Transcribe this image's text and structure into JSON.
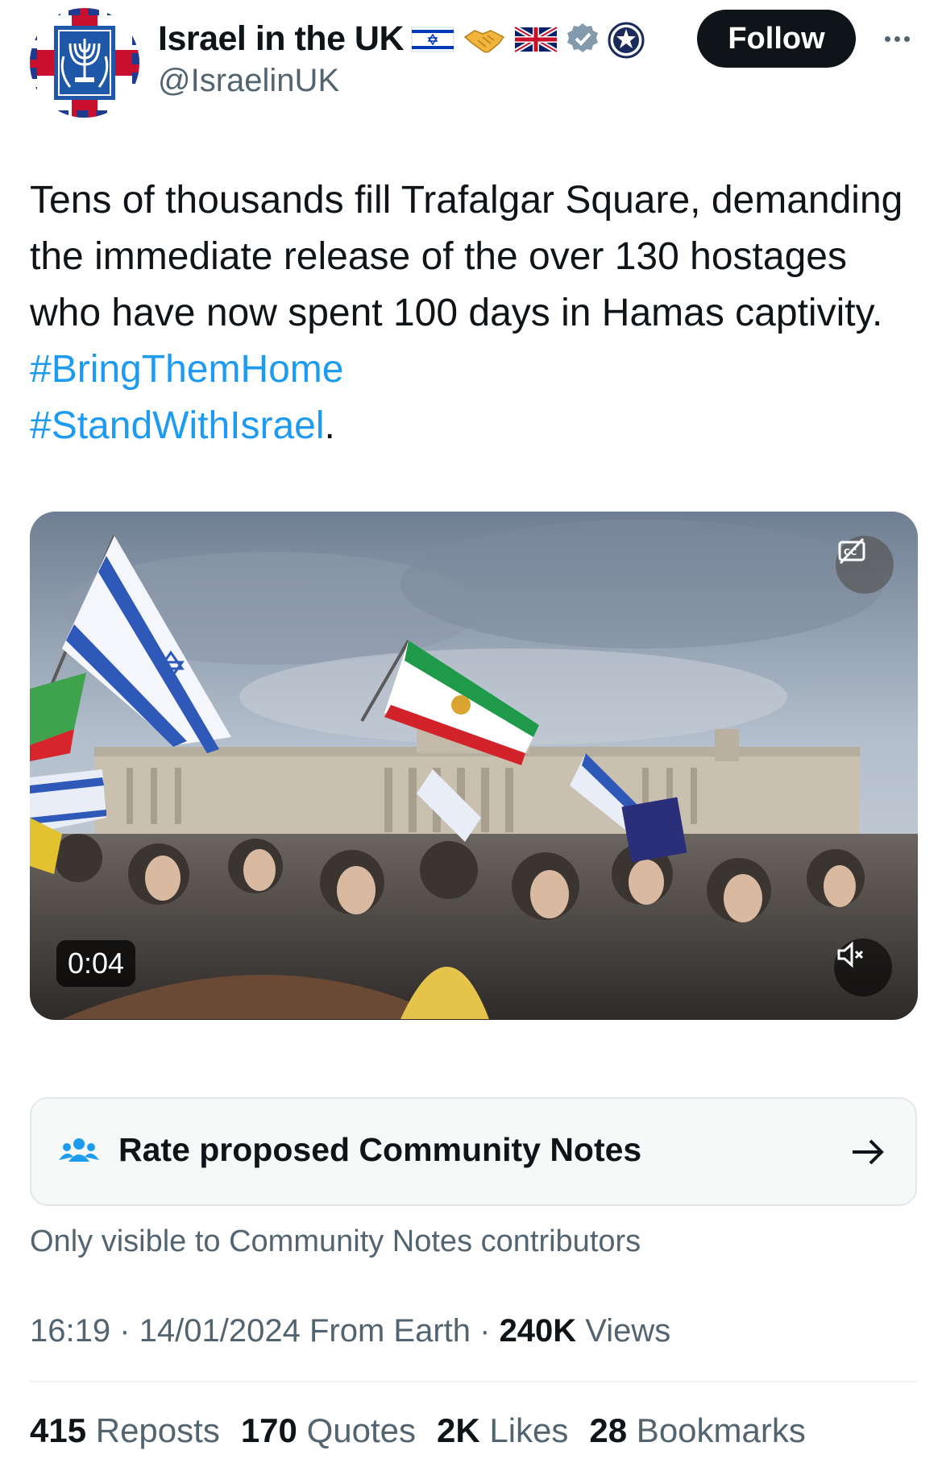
{
  "account": {
    "display_name": "Israel in the UK",
    "handle": "@IsraelinUK",
    "name_emojis": [
      "israel-flag-icon",
      "handshake-icon",
      "uk-flag-icon"
    ],
    "verified_badge": "verified-badge-icon",
    "affiliation_badge": "government-affiliation-icon"
  },
  "actions": {
    "follow_label": "Follow",
    "more_icon": "more-dots-icon"
  },
  "tweet": {
    "text": "Tens of thousands fill Trafalgar Square, demanding the immediate release of the over 130 hostages who have now spent 100 days in Hamas captivity. ",
    "hashtag_1": "#BringThemHome",
    "hashtag_2": "#StandWithIsrael",
    "text_end": "."
  },
  "media": {
    "duration": "0:04",
    "captions_icon": "captions-off-icon",
    "mute_icon": "muted-speaker-icon"
  },
  "community_notes": {
    "title": "Rate proposed Community Notes",
    "visibility_text": "Only visible to Community Notes contributors",
    "icon": "people-icon",
    "arrow_icon": "arrow-right-icon"
  },
  "meta": {
    "time": "16:19",
    "separator": " · ",
    "date": "14/01/2024",
    "source": " From Earth",
    "views_count": "240K",
    "views_label": " Views"
  },
  "stats": {
    "reposts_count": "415",
    "reposts_label": " Reposts",
    "quotes_count": "170",
    "quotes_label": " Quotes",
    "likes_count": "2K",
    "likes_label": " Likes",
    "bookmarks_count": "28",
    "bookmarks_label": " Bookmarks"
  },
  "colors": {
    "link": "#1d9bf0",
    "primary_text": "#0f1419",
    "secondary_text": "#536471",
    "follow_bg": "#0f1419"
  }
}
